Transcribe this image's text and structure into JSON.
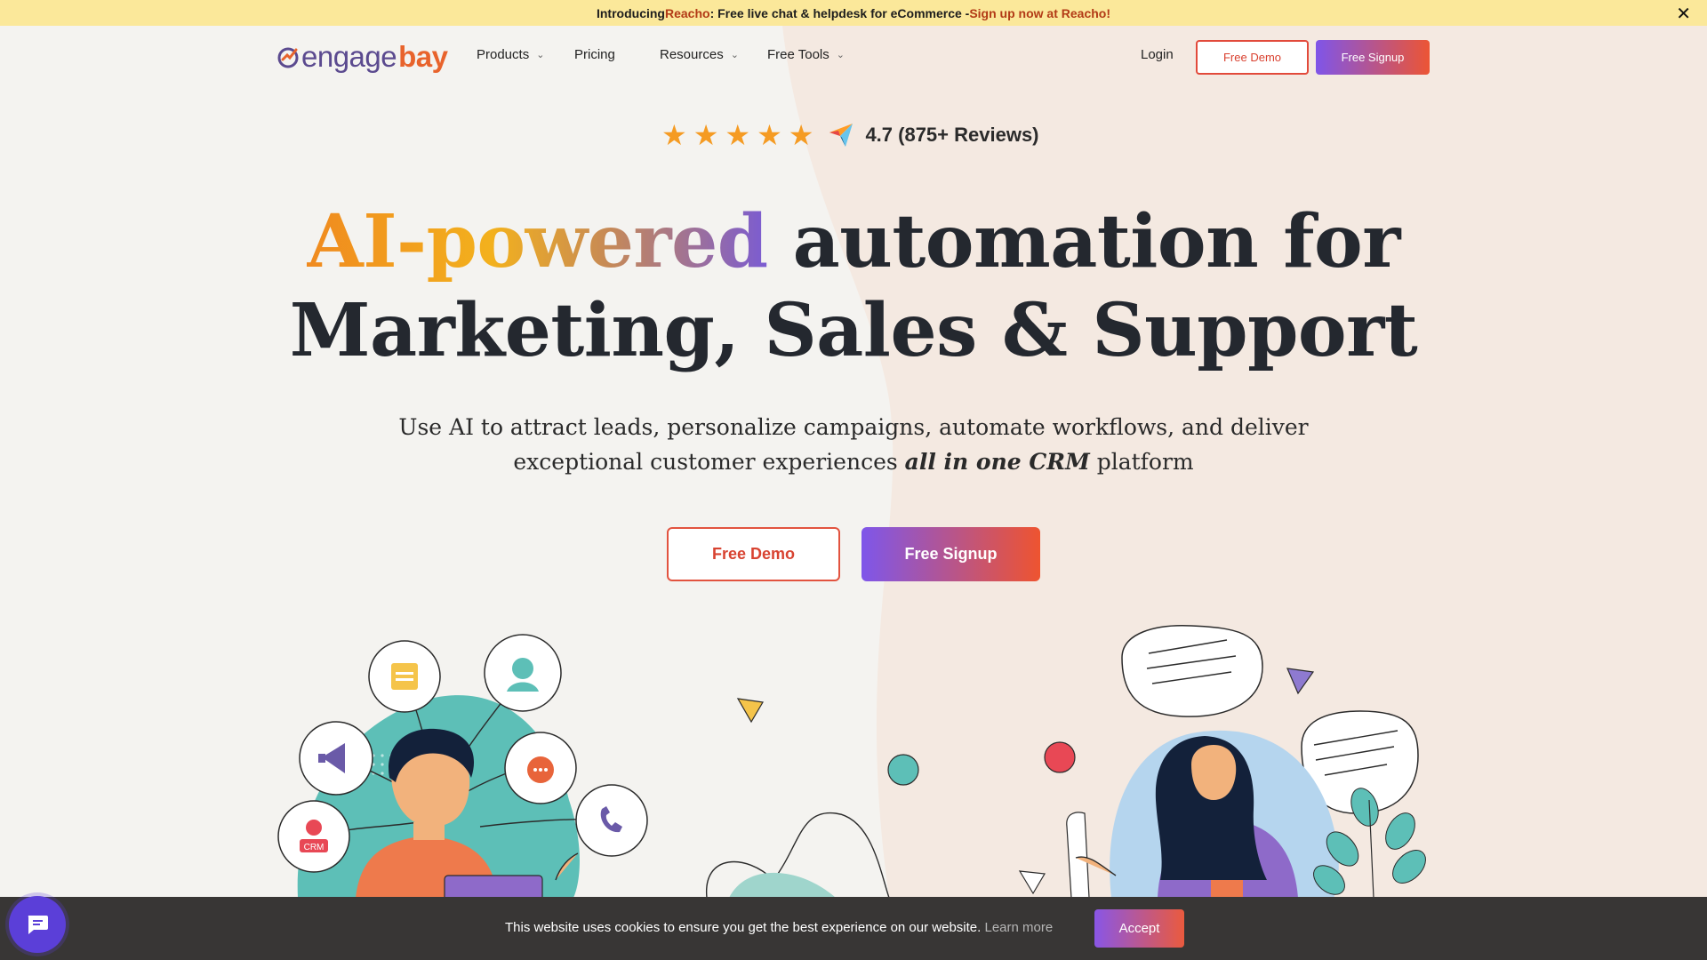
{
  "banner": {
    "intro": "Introducing ",
    "brand": "Reacho",
    "middle": ": Free live chat & helpdesk for eCommerce - ",
    "cta": "Sign up now at Reacho!",
    "close_icon": "close-icon"
  },
  "logo": {
    "part1": "engage",
    "part2": "bay"
  },
  "nav": {
    "products": "Products",
    "pricing": "Pricing",
    "resources": "Resources",
    "free_tools": "Free Tools",
    "login": "Login",
    "free_demo": "Free Demo",
    "free_signup": "Free Signup",
    "chevron_icon": "chevron-down-icon"
  },
  "rating": {
    "star_count": 5,
    "text": "4.7 (875+ Reviews)",
    "badge_icon": "capterra-icon"
  },
  "hero": {
    "headline_grad": "AI-powered",
    "headline_rest": " automation for",
    "headline_line2": "Marketing, Sales & Support",
    "sub_line1": "Use AI to attract leads, personalize campaigns, automate workflows, and deliver",
    "sub_line2_pre": "exceptional customer experiences ",
    "sub_line2_em": "all in one CRM",
    "sub_line2_post": " platform",
    "cta_demo": "Free Demo",
    "cta_signup": "Free Signup"
  },
  "illustration": {
    "crm_label": "CRM"
  },
  "cookie": {
    "text": "This website uses cookies to ensure you get the best experience on our website.",
    "learn_more": "Learn more",
    "accept": "Accept"
  },
  "colors": {
    "banner_bg": "#fbe89a",
    "accent_red": "#e2533f",
    "accent_purple": "#7e56ea",
    "teal": "#55bdb6",
    "star": "#f59b23"
  }
}
